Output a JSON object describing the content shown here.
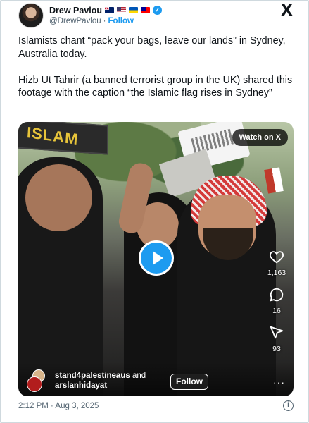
{
  "author": {
    "name": "Drew Pavlou",
    "handle": "@DrewPavlou",
    "separator": "·",
    "follow_label": "Follow",
    "flags": [
      "australia-flag",
      "usa-flag",
      "ukraine-flag",
      "taiwan-flag"
    ],
    "verified_color": "#1d9bf0"
  },
  "x_logo": "X",
  "tweet": {
    "paragraph_1": "Islamists chant “pack your bags, leave our lands” in Sydney, Australia today.",
    "paragraph_2": "Hizb Ut Tahrir (a banned terrorist group in the UK) shared this footage with the caption “the Islamic flag rises in Sydney”"
  },
  "media": {
    "sign_text": "ISLAM",
    "watch_badge": "Watch on X",
    "actions": {
      "likes": "1,163",
      "replies": "16",
      "shares": "93"
    },
    "creators": {
      "first": "stand4palestineaus",
      "and_word": "and",
      "second": "arslanhidayat"
    },
    "follow_label": "Follow",
    "more": "···"
  },
  "footer": {
    "timestamp": "2:12 PM · Aug 3, 2025",
    "info": "i"
  },
  "colors": {
    "accent": "#1d9bf0",
    "secondary_text": "#536471"
  }
}
